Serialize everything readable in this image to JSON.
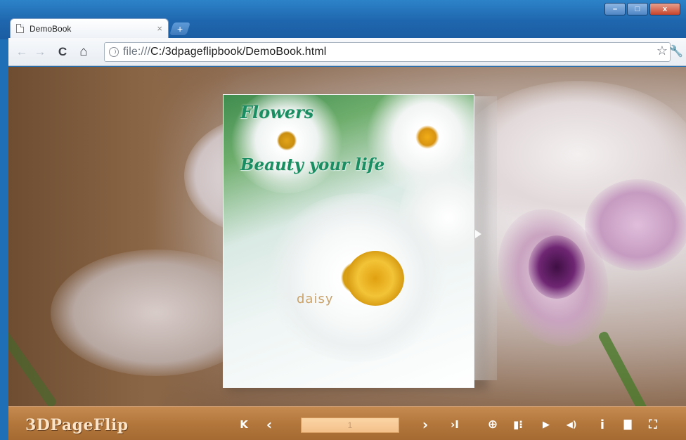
{
  "browser": {
    "tab_title": "DemoBook",
    "tab_close": "×",
    "new_tab": "+",
    "window_controls": {
      "minimize": "–",
      "maximize": "□",
      "close": "x"
    },
    "nav": {
      "back": "←",
      "forward": "→",
      "reload": "C",
      "home": "⌂"
    },
    "url_scheme": "file:///",
    "url_path": "C:/3dpageflipbook/DemoBook.html",
    "star": "☆",
    "wrench": "🔧"
  },
  "book": {
    "title": "Flowers",
    "subtitle": "Beauty your life",
    "tag": "daisy",
    "accent_color": "#1a8d62"
  },
  "controls": {
    "logo": "3DPageFlip",
    "first": "K",
    "prev": "‹",
    "page_value": "1",
    "next": "›",
    "last": "›I",
    "zoom": "⊕",
    "thumbs": "▮⁝",
    "play": "▶",
    "sound": "◀)",
    "info": "i",
    "print": "▇",
    "fullscreen": "⛶",
    "bar_color": "#b3773c"
  }
}
